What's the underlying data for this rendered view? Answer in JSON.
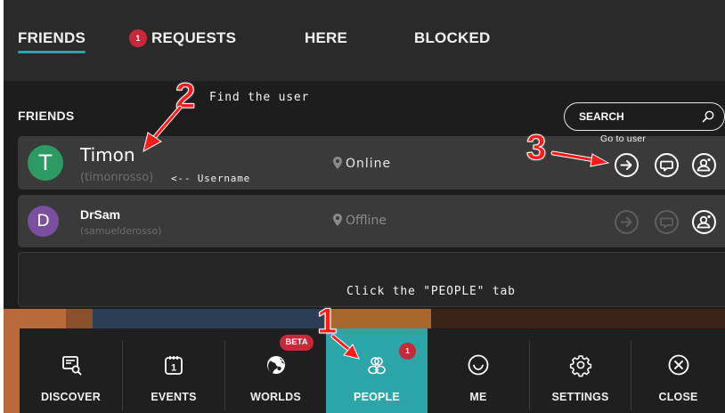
{
  "tabs": [
    {
      "label": "FRIENDS",
      "active": true
    },
    {
      "label": "REQUESTS",
      "badge": "1"
    },
    {
      "label": "HERE"
    },
    {
      "label": "BLOCKED"
    }
  ],
  "friends_section": {
    "title": "FRIENDS"
  },
  "search": {
    "placeholder": "SEARCH",
    "icon": "search-icon"
  },
  "friends": [
    {
      "initial": "T",
      "name": "Timon",
      "handle": "(timonrosso)",
      "status": "Online",
      "avatar_color": "#2e9a63",
      "status_color": "#e8e8e8"
    },
    {
      "initial": "D",
      "name": "DrSam",
      "handle": "(samuelderosso)",
      "status": "Offline",
      "avatar_color": "#7a4f9e",
      "status_color": "#8a8a8a"
    }
  ],
  "row_actions": {
    "go_to_user_tooltip": "Go to user",
    "icons": [
      "go-to-user-icon",
      "chat-icon",
      "user-options-icon"
    ]
  },
  "bottom_nav": [
    {
      "label": "DISCOVER",
      "icon": "discover-icon"
    },
    {
      "label": "EVENTS",
      "icon": "events-icon",
      "icon_text": "1"
    },
    {
      "label": "WORLDS",
      "icon": "globe-icon",
      "badge": "BETA"
    },
    {
      "label": "PEOPLE",
      "icon": "people-icon",
      "badge": "1",
      "active": true
    },
    {
      "label": "ME",
      "icon": "smiley-icon"
    },
    {
      "label": "SETTINGS",
      "icon": "gear-icon"
    },
    {
      "label": "CLOSE",
      "icon": "close-icon"
    }
  ],
  "annotations": {
    "step1_number": "1",
    "step1_text": "Click the \"PEOPLE\" tab",
    "step2_number": "2",
    "step2_text": "Find the user",
    "step3_number": "3",
    "username_note": "<-- Username"
  },
  "colors": {
    "accent": "#2ba5a8",
    "badge": "#c8283a",
    "annotation": "#ff1a1a"
  }
}
